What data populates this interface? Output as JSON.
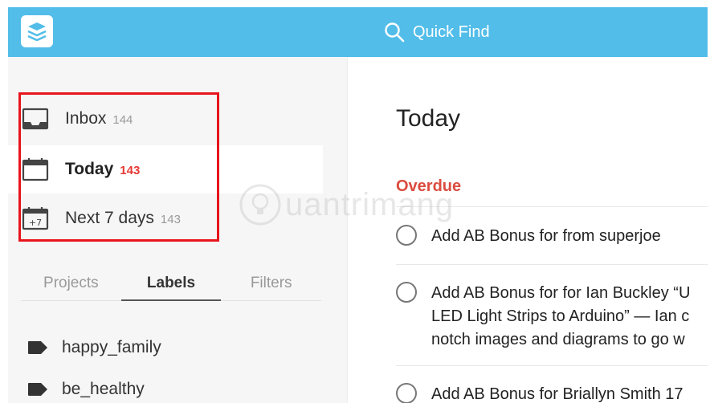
{
  "colors": {
    "header": "#52bde9",
    "accent_red": "#db4c3f",
    "count_red": "#e53935",
    "highlight": "#e8141c"
  },
  "header": {
    "logo_icon": "todoist-logo-icon",
    "search_icon": "search-icon",
    "search_label": "Quick Find"
  },
  "sidebar": {
    "nav": [
      {
        "icon": "inbox-icon",
        "label": "Inbox",
        "count": "144",
        "active": false
      },
      {
        "icon": "calendar-icon",
        "label": "Today",
        "count": "143",
        "active": true
      },
      {
        "icon": "calendar-plus7-icon",
        "label": "Next 7 days",
        "count": "143",
        "active": false
      }
    ],
    "tabs": [
      {
        "label": "Projects",
        "active": false
      },
      {
        "label": "Labels",
        "active": true
      },
      {
        "label": "Filters",
        "active": false
      }
    ],
    "labels": [
      {
        "icon": "tag-icon",
        "name": "happy_family"
      },
      {
        "icon": "tag-icon",
        "name": "be_healthy"
      }
    ]
  },
  "main": {
    "title": "Today",
    "section": "Overdue",
    "tasks": [
      {
        "lines": [
          "Add AB Bonus for from superjoe"
        ]
      },
      {
        "lines": [
          "Add AB Bonus for for Ian Buckley “U",
          "LED Light Strips to Arduino” — Ian c",
          "notch images and diagrams to go w"
        ]
      },
      {
        "lines": [
          "Add AB Bonus for Briallyn Smith 17"
        ]
      }
    ]
  },
  "watermark": {
    "text": "uantrimang"
  }
}
